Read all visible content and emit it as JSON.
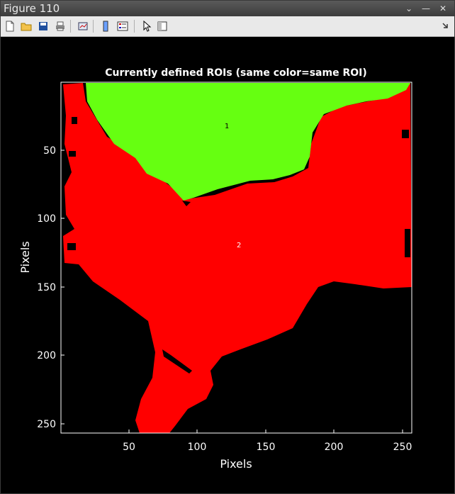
{
  "window": {
    "title": "Figure 110"
  },
  "toolbar": {
    "items": [
      "new-figure",
      "open-file",
      "save",
      "print",
      "link-plot",
      "colorbar",
      "legend",
      "edit-plot",
      "property-inspector"
    ]
  },
  "plot": {
    "title": "Currently defined ROIs (same color=same ROI)",
    "xlabel": "Pixels",
    "ylabel": "Pixels",
    "xticks": [
      "50",
      "100",
      "150",
      "200",
      "250"
    ],
    "yticks": [
      "50",
      "100",
      "150",
      "200",
      "250"
    ],
    "roi_labels": [
      "1",
      "2"
    ],
    "colors": {
      "roi1": "#66ff11",
      "roi2": "#ff0000",
      "background": "#000000"
    }
  },
  "chart_data": {
    "type": "heatmap",
    "title": "Currently defined ROIs (same color=same ROI)",
    "xlabel": "Pixels",
    "ylabel": "Pixels",
    "xlim": [
      1,
      256
    ],
    "ylim": [
      1,
      256
    ],
    "regions": [
      {
        "label": "1",
        "color": "#66ff11",
        "label_at": [
          120,
          32
        ]
      },
      {
        "label": "2",
        "color": "#ff0000",
        "label_at": [
          130,
          120
        ]
      }
    ]
  }
}
